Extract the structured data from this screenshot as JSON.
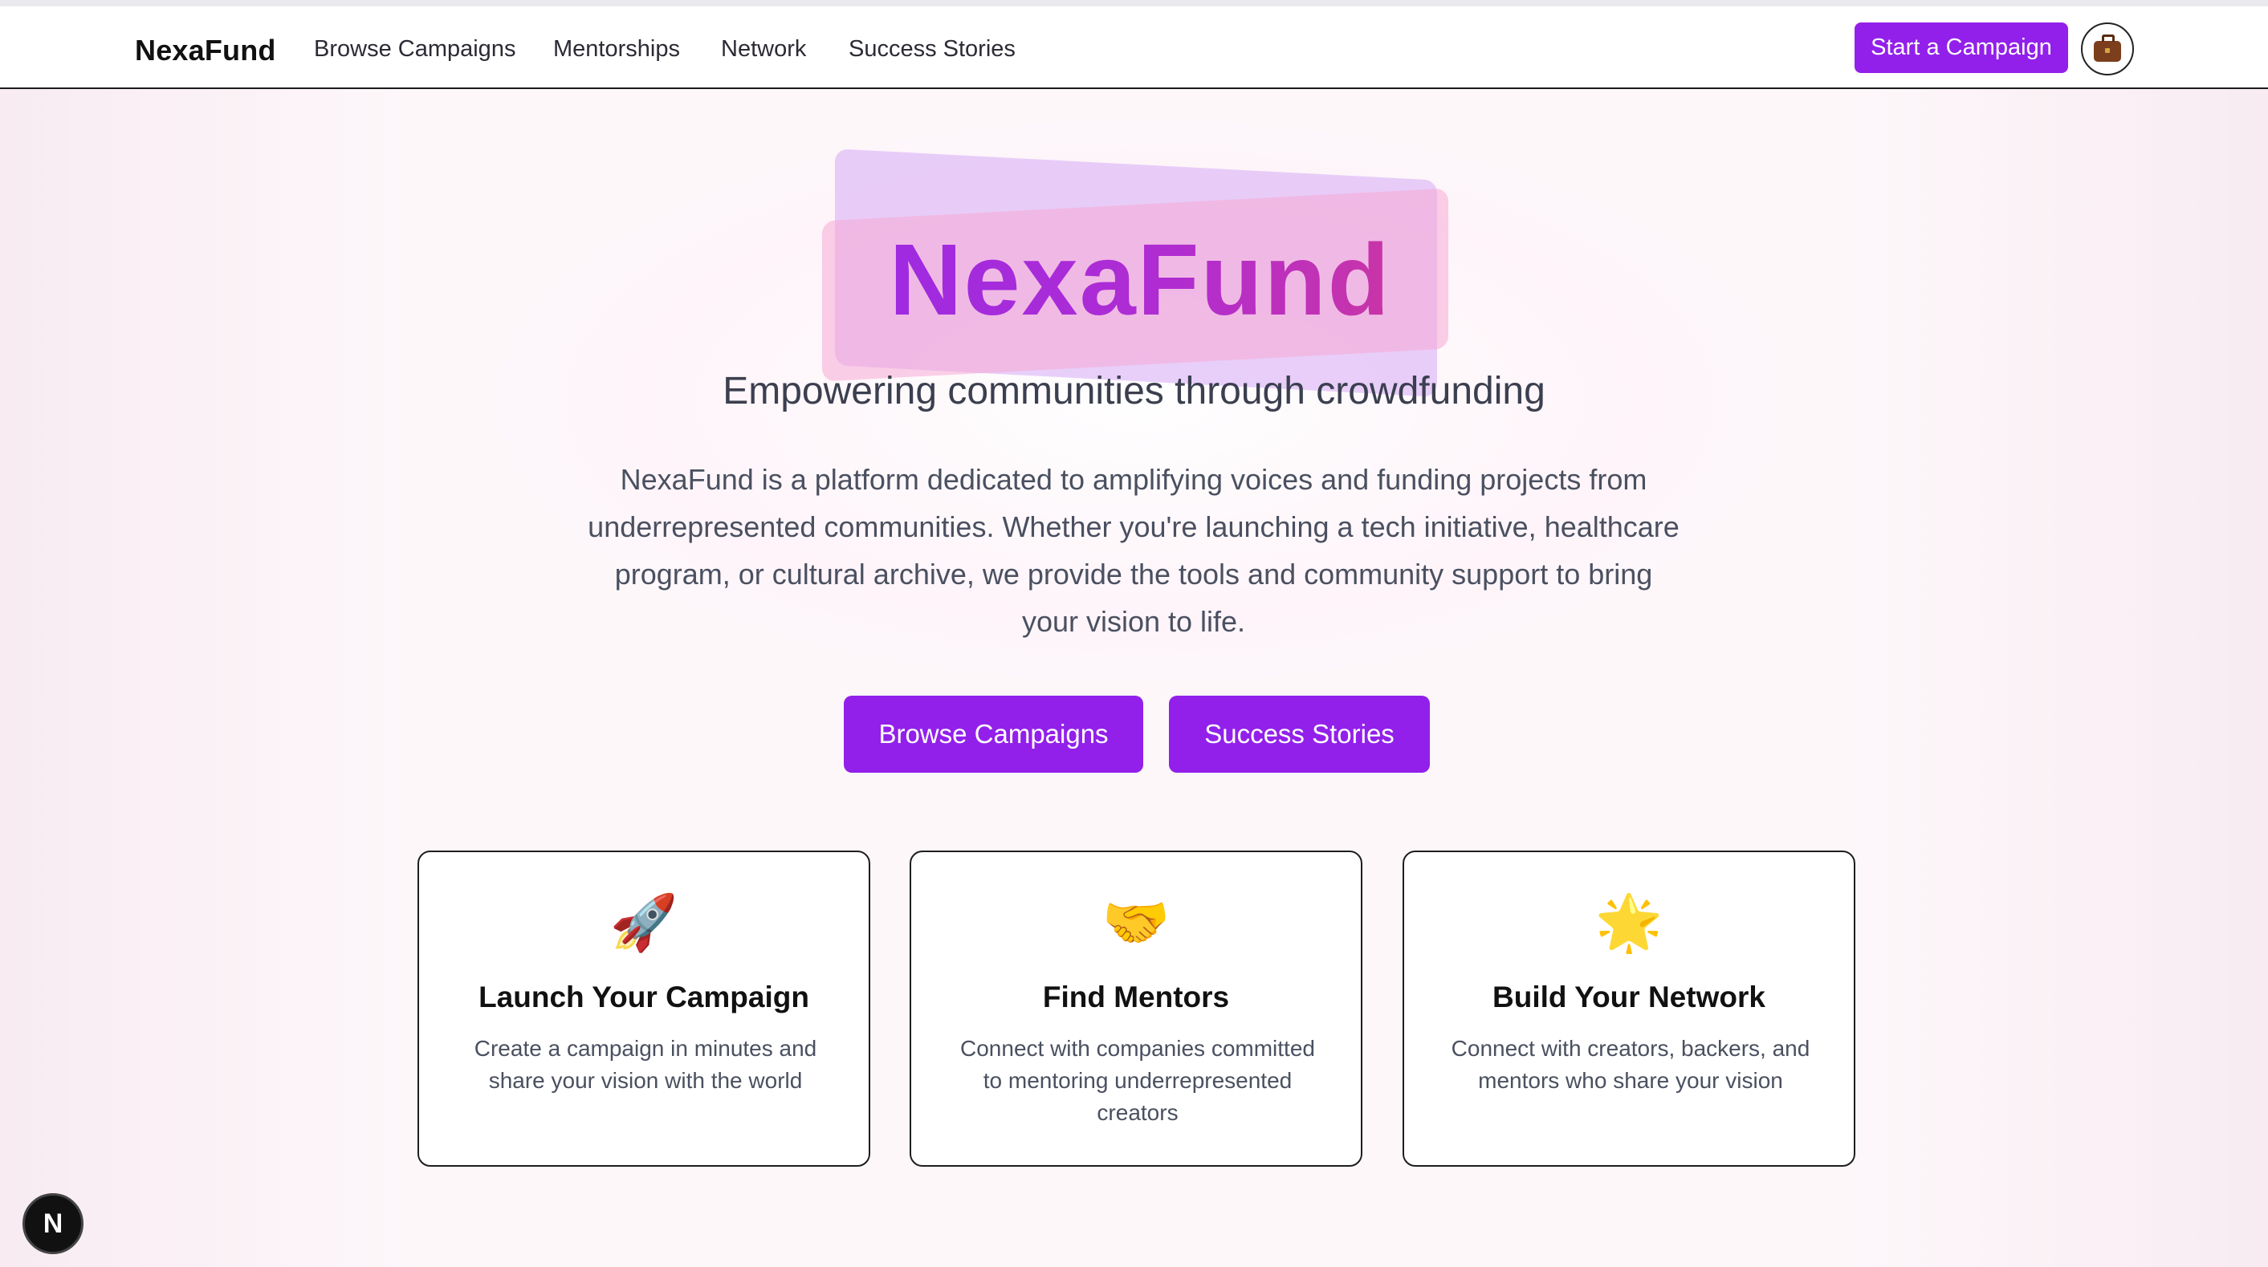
{
  "nav": {
    "brand": "NexaFund",
    "links": [
      "Browse Campaigns",
      "Mentorships",
      "Network",
      "Success Stories"
    ],
    "cta_label": "Start a Campaign",
    "profile_icon": "briefcase-icon"
  },
  "hero": {
    "title": "NexaFund",
    "subtitle": "Empowering communities through crowdfunding",
    "description": "NexaFund is a platform dedicated to amplifying voices and funding projects from underrepresented communities. Whether you're launching a tech initiative, healthcare program, or cultural archive, we provide the tools and community support to bring your vision to life.",
    "buttons": [
      "Browse Campaigns",
      "Success Stories"
    ]
  },
  "features": [
    {
      "icon": "🚀",
      "icon_name": "rocket-icon",
      "title": "Launch Your Campaign",
      "description": "Create a campaign in minutes and share your vision with the world"
    },
    {
      "icon": "🤝",
      "icon_name": "handshake-icon",
      "title": "Find Mentors",
      "description": "Connect with companies committed to mentoring underrepresented creators"
    },
    {
      "icon": "🌟",
      "icon_name": "star-icon",
      "title": "Build Your Network",
      "description": "Connect with creators, backers, and mentors who share your vision"
    }
  ],
  "badge": {
    "letter": "N"
  },
  "colors": {
    "accent": "#9220ea",
    "title_gradient_start": "#9a2ae6",
    "title_gradient_end": "#d23897",
    "background": "#fdf7fa"
  }
}
